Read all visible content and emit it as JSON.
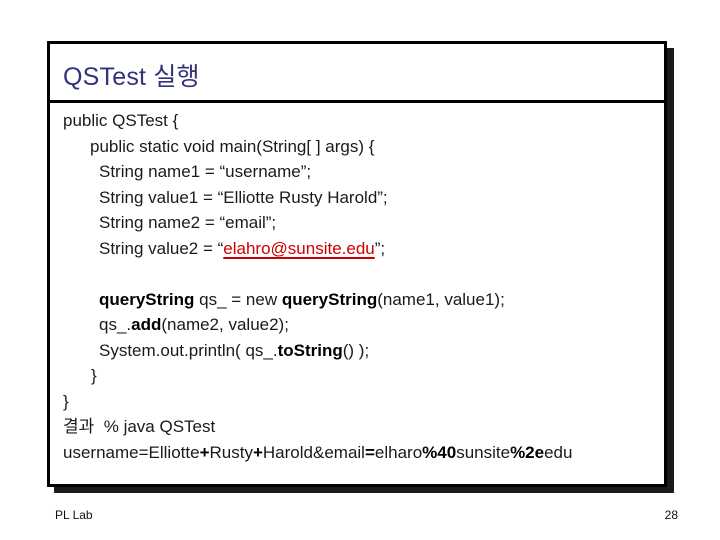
{
  "slide": {
    "title": "QSTest 실행",
    "footer_left": "PL Lab",
    "page_number": "28",
    "colors": {
      "title": "#33337a",
      "link": "#cc0000",
      "shadow": "#1a1a1a"
    }
  },
  "code": {
    "line1": "public QSTest {",
    "line2": "public static void main(String[ ] args) {",
    "line3": "String name1 = “username”;",
    "line4": "String value1 = “Elliotte Rusty Harold”;",
    "line5": "String name2 = “email”;",
    "line6_prefix": "String value2 = “",
    "line6_link": "elahro@sunsite.edu",
    "line6_suffix": "”;",
    "line7_a": "queryString",
    "line7_b": " qs_ = new ",
    "line7_c": "queryString",
    "line7_d": "(name1, value1);",
    "line8_a": "qs_.",
    "line8_b": "add",
    "line8_c": "(name2, value2);",
    "line9_a": "System.out.println( qs_.",
    "line9_b": "toString",
    "line9_c": "() );",
    "line10": "}",
    "line11": "}"
  },
  "result": {
    "label_line": "결과  % java QSTest",
    "output_parts": [
      {
        "text": "username=Elliotte",
        "bold": false
      },
      {
        "text": "+",
        "bold": true
      },
      {
        "text": "Rusty",
        "bold": false
      },
      {
        "text": "+",
        "bold": true
      },
      {
        "text": "Harold&email",
        "bold": false
      },
      {
        "text": "=",
        "bold": true
      },
      {
        "text": "elharo",
        "bold": false
      },
      {
        "text": "%40",
        "bold": true
      },
      {
        "text": "sunsite",
        "bold": false
      },
      {
        "text": "%2e",
        "bold": true
      },
      {
        "text": "edu",
        "bold": false
      }
    ]
  }
}
